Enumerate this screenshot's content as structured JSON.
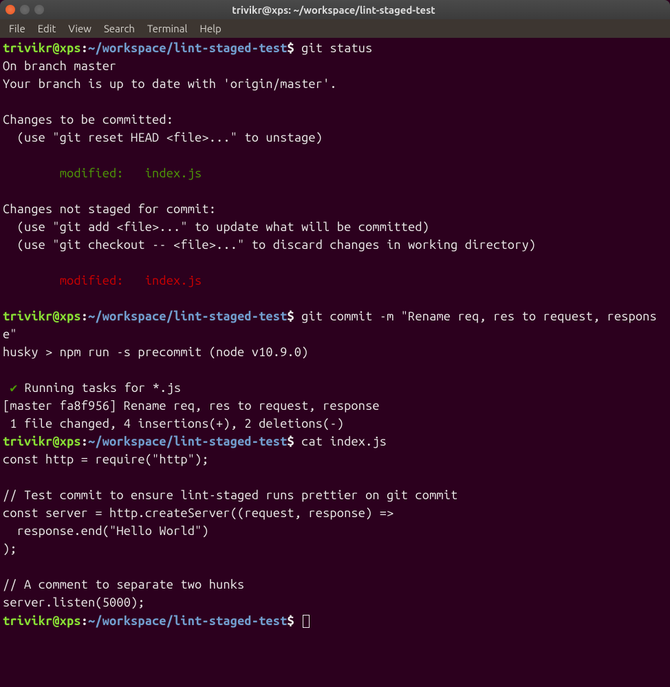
{
  "window": {
    "title": "trivikr@xps: ~/workspace/lint-staged-test"
  },
  "menu": {
    "file": "File",
    "edit": "Edit",
    "view": "View",
    "search": "Search",
    "terminal": "Terminal",
    "help": "Help"
  },
  "prompt": {
    "user": "trivikr@xps",
    "sep": ":",
    "path": "~/workspace/lint-staged-test",
    "dollar": "$"
  },
  "commands": {
    "cmd1": " git status",
    "cmd2": " git commit -m \"Rename req, res to request, response\"",
    "cmd3": " cat index.js"
  },
  "output": {
    "status": {
      "l1": "On branch master",
      "l2": "Your branch is up to date with 'origin/master'.",
      "l3": "Changes to be committed:",
      "l4": "  (use \"git reset HEAD <file>...\" to unstage)",
      "l5": "        modified:   index.js",
      "l6": "Changes not staged for commit:",
      "l7": "  (use \"git add <file>...\" to update what will be committed)",
      "l8": "  (use \"git checkout -- <file>...\" to discard changes in working directory)",
      "l9": "        modified:   index.js"
    },
    "commit": {
      "l1": "husky > npm run -s precommit (node v10.9.0)",
      "l2": " ✔ ",
      "l2b": "Running tasks for *.js",
      "l3": "[master fa8f956] Rename req, res to request, response",
      "l4": " 1 file changed, 4 insertions(+), 2 deletions(-)"
    },
    "cat": {
      "l1": "const http = require(\"http\");",
      "l2": "// Test commit to ensure lint-staged runs prettier on git commit",
      "l3": "const server = http.createServer((request, response) =>",
      "l4": "  response.end(\"Hello World\")",
      "l5": ");",
      "l6": "// A comment to separate two hunks",
      "l7": "server.listen(5000);"
    }
  }
}
